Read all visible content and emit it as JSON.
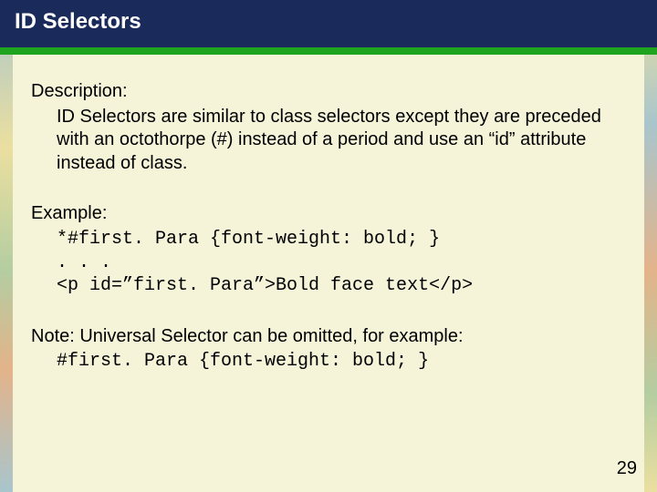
{
  "title": "ID Selectors",
  "description_label": "Description:",
  "description_body": "ID Selectors are similar to class selectors except they are preceded with an octothorpe (#) instead of a period and use an “id” attribute instead of class.",
  "example_label": "Example:",
  "example_code_line1": "*#first. Para {font-weight: bold; }",
  "example_code_line2": ". . .",
  "example_code_line3": "<p id=”first. Para”>Bold face text</p>",
  "note_label": "Note: Universal Selector can be omitted, for example:",
  "note_code": "#first. Para {font-weight: bold; }",
  "page_number": "29"
}
